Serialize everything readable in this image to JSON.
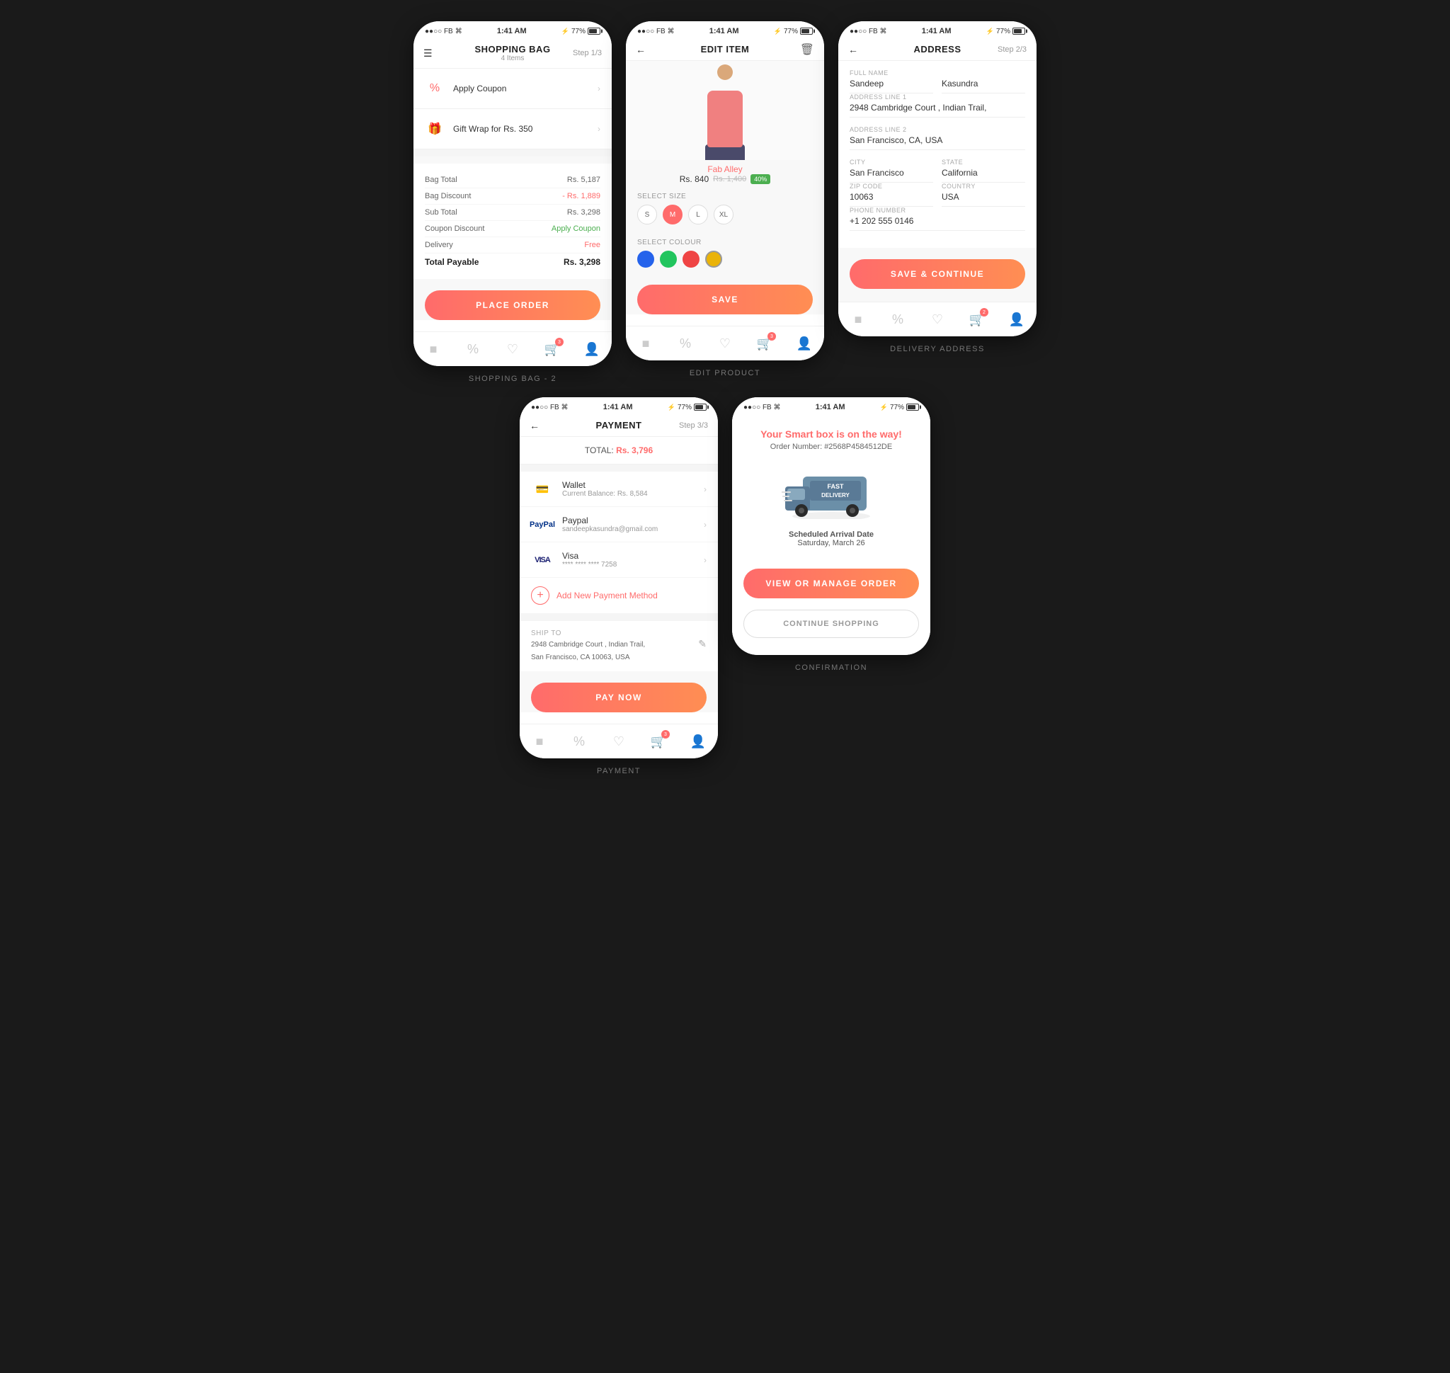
{
  "screens": {
    "shopping_bag": {
      "title": "SHOPPING BAG",
      "subtitle": "4 Items",
      "step": "Step 1/3",
      "apply_coupon": "Apply Coupon",
      "gift_wrap": "Gift Wrap for Rs. 350",
      "bag_total_label": "Bag Total",
      "bag_total": "Rs. 5,187",
      "bag_discount_label": "Bag Discount",
      "bag_discount": "- Rs. 1,889",
      "sub_total_label": "Sub Total",
      "sub_total": "Rs. 3,298",
      "coupon_discount_label": "Coupon Discount",
      "coupon_apply": "Apply Coupon",
      "delivery_label": "Delivery",
      "delivery": "Free",
      "total_payable_label": "Total Payable",
      "total_payable": "Rs. 3,298",
      "place_order": "PLACE ORDER",
      "label": "SHOPPING BAG - 2"
    },
    "edit_product": {
      "title": "EDIT ITEM",
      "product_name": "Fab Alley",
      "price_new": "Rs. 840",
      "price_old": "Rs. 1,400",
      "discount": "40%",
      "size_label": "SELECT SIZE",
      "sizes": [
        "S",
        "M",
        "L",
        "XL"
      ],
      "selected_size": "M",
      "color_label": "SELECT COLOUR",
      "colors": [
        "#2563eb",
        "#22c55e",
        "#ef4444",
        "#eab308"
      ],
      "save_btn": "SAVE",
      "label": "EDIT PRODUCT"
    },
    "address": {
      "title": "ADDRESS",
      "step": "Step 2/3",
      "full_name_label": "Full Name",
      "first_name": "Sandeep",
      "last_name": "Kasundra",
      "address1_label": "Address Line 1",
      "address1": "2948 Cambridge Court , Indian Trail,",
      "address2_label": "Address Line 2",
      "address2": "San Francisco, CA, USA",
      "city_label": "City",
      "city": "San Francisco",
      "state_label": "State",
      "state": "California",
      "zip_label": "Zip Code",
      "zip": "10063",
      "country_label": "Country",
      "country": "USA",
      "phone_label": "Phone Number",
      "phone": "+1 202 555 0146",
      "save_btn": "SAVE & CONTINUE",
      "label": "DELIVERY ADDRESS"
    },
    "payment": {
      "title": "PAYMENT",
      "step": "Step 3/3",
      "total_label": "TOTAL:",
      "total_amount": "Rs. 3,796",
      "wallet_label": "Wallet",
      "wallet_detail": "Current Balance: Rs. 8,584",
      "paypal_label": "Paypal",
      "paypal_detail": "sandeepkasundra@gmail.com",
      "visa_label": "Visa",
      "visa_detail": "**** **** **** 7258",
      "add_payment": "Add New Payment Method",
      "ship_to_label": "SHIP TO",
      "ship_address": "2948 Cambridge Court , Indian Trail,",
      "ship_city": "San Francisco, CA 10063, USA",
      "pay_now": "PAY NOW",
      "label": "PAYMENT"
    },
    "confirmation": {
      "title": "Your Smart box is on the way!",
      "order_prefix": "Order Number:",
      "order_number": "#2568P4584512DE",
      "truck_text1": "FAST",
      "truck_text2": "DELIVERY",
      "arrival_label": "Scheduled Arrival Date",
      "arrival_date": "Saturday, March 26",
      "view_order_btn": "VIEW OR MANAGE ORDER",
      "continue_btn": "CONTINUE SHOPPING",
      "label": "CONFIRMATION"
    }
  },
  "status_bar": {
    "carrier": "●●○○ FB",
    "wifi": "WiFi",
    "time": "1:41 AM",
    "bluetooth": "BT",
    "battery": "77%"
  },
  "bottom_nav": {
    "home_count": "3"
  }
}
